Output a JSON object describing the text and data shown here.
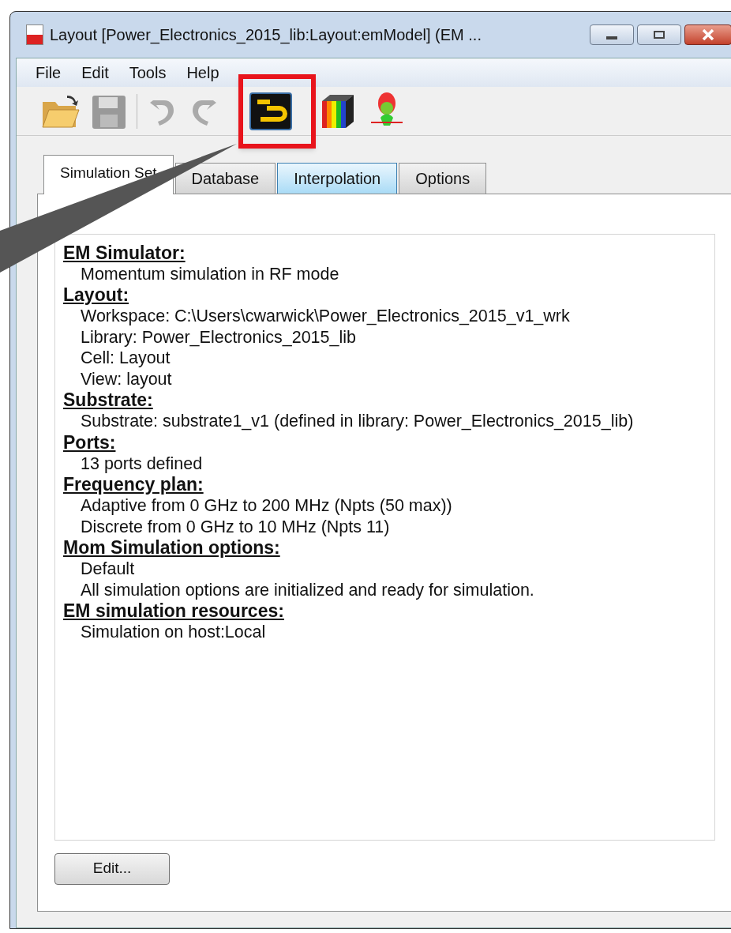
{
  "window": {
    "title": "Layout [Power_Electronics_2015_lib:Layout:emModel] (EM ..."
  },
  "menu": [
    "File",
    "Edit",
    "Tools",
    "Help"
  ],
  "tabs": [
    {
      "label": "Simulation Set",
      "selected": true,
      "highlighted": false
    },
    {
      "label": "Database",
      "selected": false,
      "highlighted": false
    },
    {
      "label": "Interpolation",
      "selected": false,
      "highlighted": true
    },
    {
      "label": "Options",
      "selected": false,
      "highlighted": false
    }
  ],
  "summary": [
    {
      "heading": "EM Simulator:",
      "lines": [
        "Momentum simulation in RF mode"
      ]
    },
    {
      "heading": "Layout:",
      "lines": [
        "Workspace: C:\\Users\\cwarwick\\Power_Electronics_2015_v1_wrk",
        "Library: Power_Electronics_2015_lib",
        "Cell: Layout",
        "View: layout"
      ]
    },
    {
      "heading": "Substrate:",
      "lines": [
        "Substrate: substrate1_v1 (defined in library: Power_Electronics_2015_lib)"
      ]
    },
    {
      "heading": "Ports:",
      "lines": [
        "13 ports defined"
      ]
    },
    {
      "heading": "Frequency plan:",
      "lines": [
        "Adaptive from 0 GHz to 200 MHz (Npts (50 max))",
        "Discrete from 0 GHz to 10 MHz (Npts 11)"
      ]
    },
    {
      "heading": "Mom Simulation options:",
      "lines": [
        "Default",
        "All simulation options are initialized and ready for simulation."
      ]
    },
    {
      "heading": "EM simulation resources:",
      "lines": [
        "Simulation on host:Local"
      ]
    }
  ],
  "edit_button": "Edit..."
}
